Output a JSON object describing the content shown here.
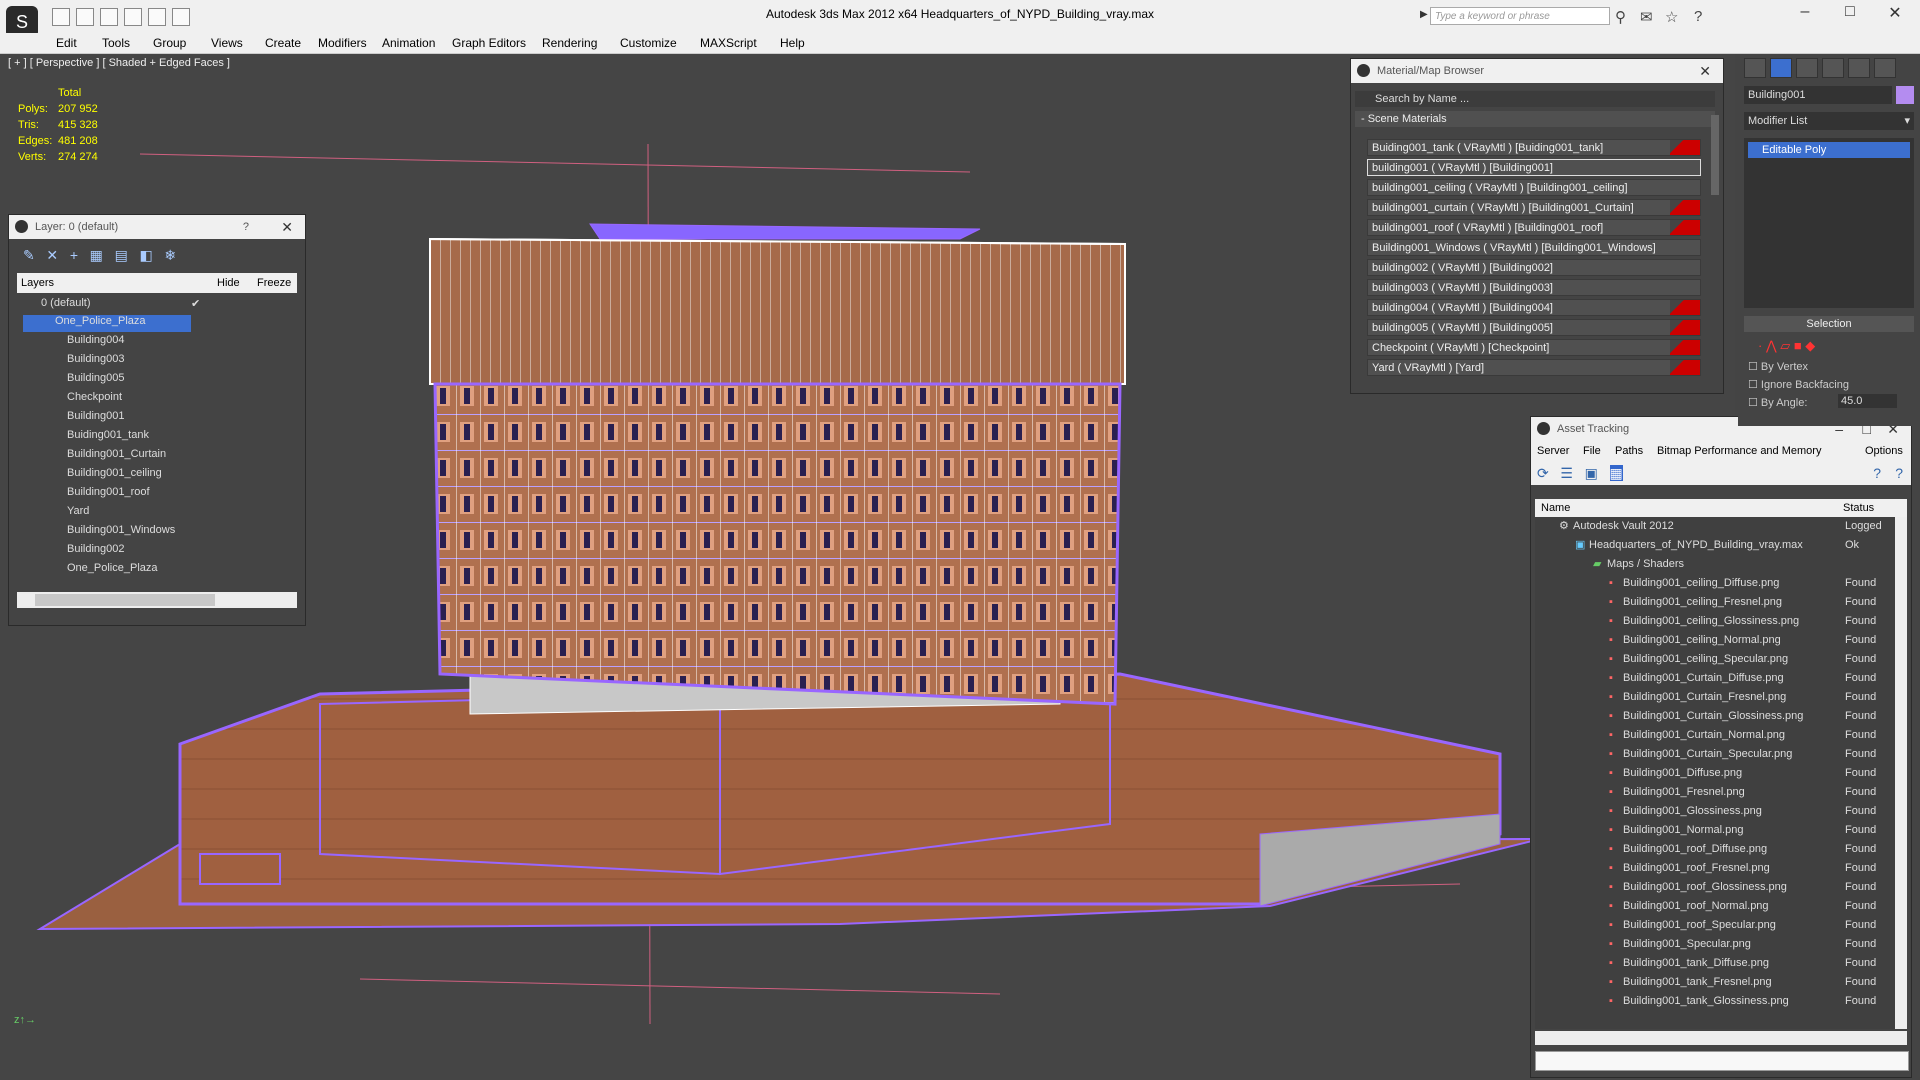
{
  "app": {
    "title": "Autodesk 3ds Max  2012 x64      Headquarters_of_NYPD_Building_vray.max",
    "search_placeholder": "Type a keyword or phrase"
  },
  "menu": [
    "Edit",
    "Tools",
    "Group",
    "Views",
    "Create",
    "Modifiers",
    "Animation",
    "Graph Editors",
    "Rendering",
    "Customize",
    "MAXScript",
    "Help"
  ],
  "viewport": {
    "label": "[ + ] [ Perspective ] [ Shaded + Edged Faces ]",
    "stats": {
      "header": "Total",
      "rows": [
        {
          "label": "Polys:",
          "value": "207 952"
        },
        {
          "label": "Tris:",
          "value": "415 328"
        },
        {
          "label": "Edges:",
          "value": "481 208"
        },
        {
          "label": "Verts:",
          "value": "274 274"
        }
      ]
    }
  },
  "layer_panel": {
    "title": "Layer: 0 (default)",
    "help": "?",
    "columns": {
      "layers": "Layers",
      "hide": "Hide",
      "freeze": "Freeze"
    },
    "layers": [
      "0 (default)",
      "One_Police_Plaza"
    ],
    "children": [
      "Building004",
      "Building003",
      "Building005",
      "Checkpoint",
      "Building001",
      "Buiding001_tank",
      "Building001_Curtain",
      "Building001_ceiling",
      "Building001_roof",
      "Yard",
      "Building001_Windows",
      "Building002",
      "One_Police_Plaza"
    ]
  },
  "material_browser": {
    "title": "Material/Map Browser",
    "search": "Search by Name ...",
    "section": "- Scene Materials",
    "items": [
      {
        "label": "Buiding001_tank  ( VRayMtl )  [Buiding001_tank]",
        "red": true
      },
      {
        "label": "building001  ( VRayMtl )  [Building001]",
        "red": false,
        "selected": true
      },
      {
        "label": "building001_ceiling  ( VRayMtl )  [Building001_ceiling]",
        "red": false
      },
      {
        "label": "building001_curtain  ( VRayMtl )  [Building001_Curtain]",
        "red": true
      },
      {
        "label": "building001_roof  ( VRayMtl )  [Building001_roof]",
        "red": true
      },
      {
        "label": "Building001_Windows  ( VRayMtl )  [Building001_Windows]",
        "red": false
      },
      {
        "label": "building002  ( VRayMtl )  [Building002]",
        "red": false
      },
      {
        "label": "building003  ( VRayMtl )  [Building003]",
        "red": false
      },
      {
        "label": "building004  ( VRayMtl )  [Building004]",
        "red": true
      },
      {
        "label": "building005  ( VRayMtl )  [Building005]",
        "red": true
      },
      {
        "label": "Checkpoint  ( VRayMtl )  [Checkpoint]",
        "red": true
      },
      {
        "label": "Yard  ( VRayMtl )  [Yard]",
        "red": true
      }
    ]
  },
  "asset_tracking": {
    "title": "Asset Tracking",
    "menu": [
      "Server",
      "File",
      "Paths",
      "Bitmap Performance and Memory",
      "Options"
    ],
    "columns": {
      "name": "Name",
      "status": "Status"
    },
    "vault": {
      "name": "Autodesk Vault 2012",
      "status": "Logged"
    },
    "file": {
      "name": "Headquarters_of_NYPD_Building_vray.max",
      "status": "Ok"
    },
    "group": "Maps / Shaders",
    "maps": [
      "Building001_ceiling_Diffuse.png",
      "Building001_ceiling_Fresnel.png",
      "Building001_ceiling_Glossiness.png",
      "Building001_ceiling_Normal.png",
      "Building001_ceiling_Specular.png",
      "Building001_Curtain_Diffuse.png",
      "Building001_Curtain_Fresnel.png",
      "Building001_Curtain_Glossiness.png",
      "Building001_Curtain_Normal.png",
      "Building001_Curtain_Specular.png",
      "Building001_Diffuse.png",
      "Building001_Fresnel.png",
      "Building001_Glossiness.png",
      "Building001_Normal.png",
      "Building001_roof_Diffuse.png",
      "Building001_roof_Fresnel.png",
      "Building001_roof_Glossiness.png",
      "Building001_roof_Normal.png",
      "Building001_roof_Specular.png",
      "Building001_Specular.png",
      "Building001_tank_Diffuse.png",
      "Building001_tank_Fresnel.png",
      "Building001_tank_Glossiness.png"
    ],
    "map_status": "Found"
  },
  "command_panel": {
    "object_name": "Building001",
    "modifier_list": "Modifier List",
    "stack_item": "Editable Poly",
    "selection_title": "Selection",
    "by_vertex": "By Vertex",
    "ignore_backfacing": "Ignore Backfacing",
    "by_angle": "By Angle:",
    "angle_value": "45.0"
  },
  "colors": {
    "selected_layer": "#3c6fcf",
    "wire": "#9966ff",
    "brick": "#a36040"
  }
}
